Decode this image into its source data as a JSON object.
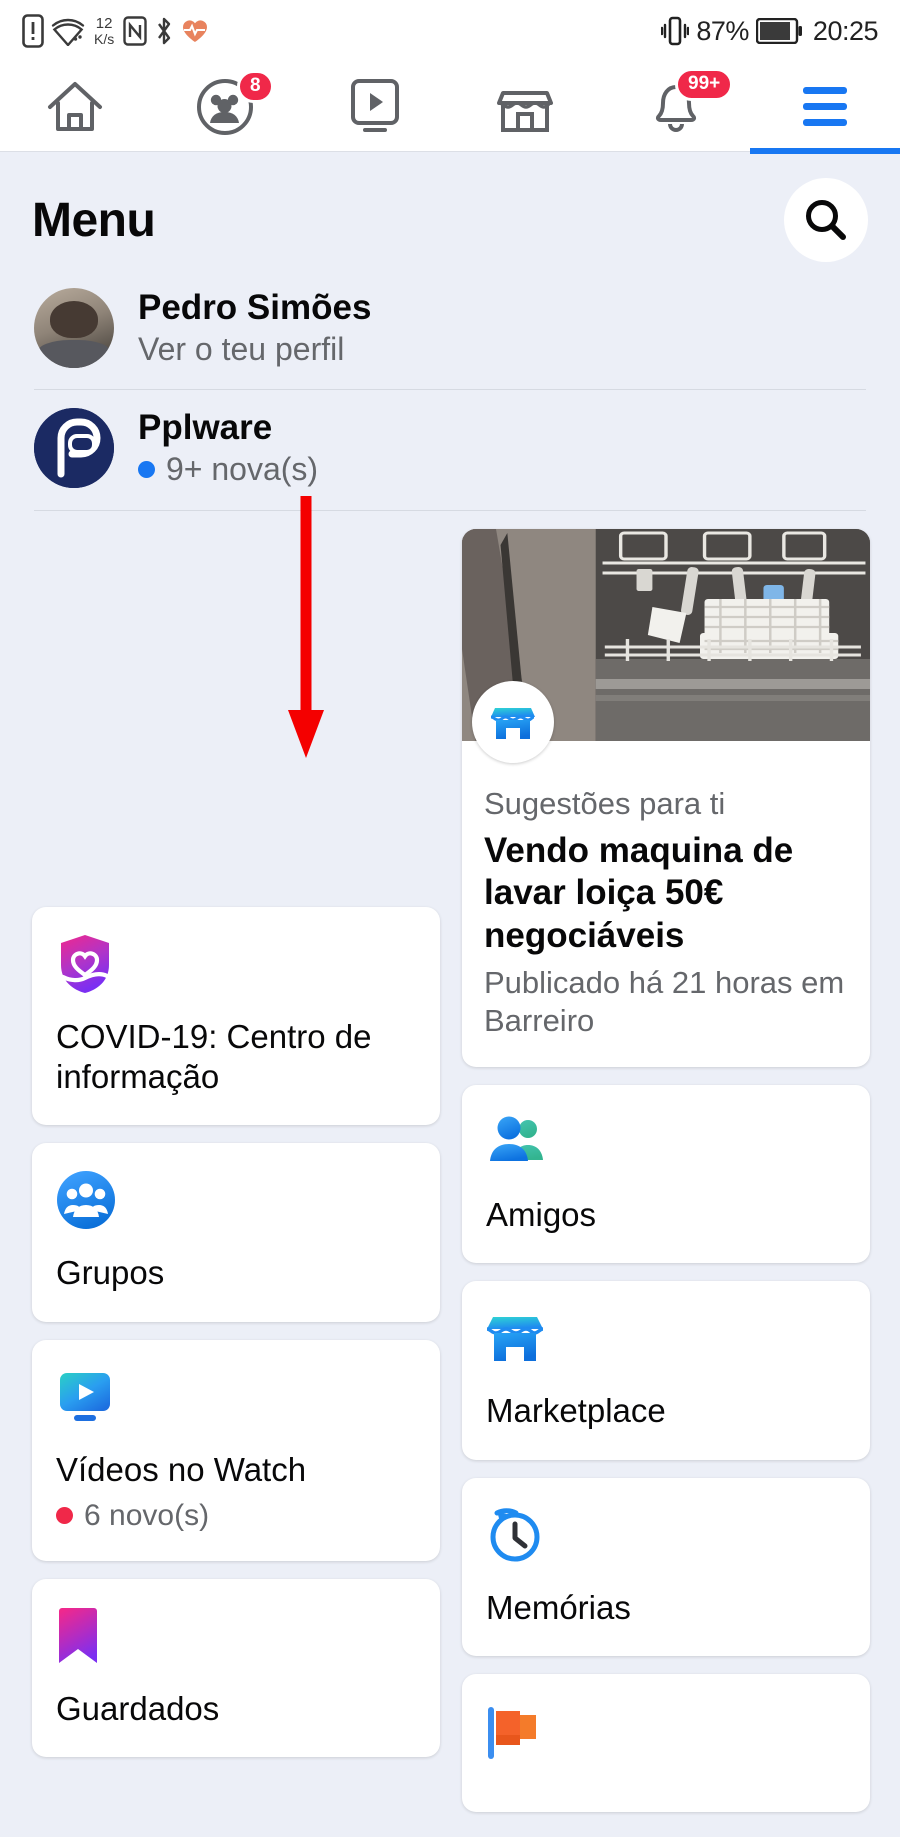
{
  "statusbar": {
    "network_speed_value": "12",
    "network_speed_unit": "K/s",
    "battery_percent": "87%",
    "clock": "20:25",
    "icons": [
      "sim-card-alert-icon",
      "wifi-icon",
      "nfc-icon",
      "bluetooth-icon",
      "heart-rate-icon",
      "vibrate-icon",
      "battery-icon"
    ]
  },
  "topnav": {
    "tabs": [
      {
        "name": "home-tab",
        "icon": "home-icon",
        "badge": ""
      },
      {
        "name": "friends-tab",
        "icon": "friends-icon",
        "badge": "8"
      },
      {
        "name": "watch-tab",
        "icon": "video-play-icon",
        "badge": ""
      },
      {
        "name": "marketplace-tab",
        "icon": "storefront-icon",
        "badge": ""
      },
      {
        "name": "notifications-tab",
        "icon": "bell-icon",
        "badge": "99+"
      },
      {
        "name": "menu-tab",
        "icon": "hamburger-icon",
        "badge": ""
      }
    ],
    "active_tab": "menu-tab",
    "accent_color": "#1877f2",
    "badge_color": "#f02849"
  },
  "header": {
    "title": "Menu",
    "search_icon": "search-icon"
  },
  "profile": {
    "name": "Pedro Simões",
    "subtitle": "Ver o teu perfil"
  },
  "page_shortcut": {
    "name": "Pplware",
    "badge_text": "9+ nova(s)",
    "dot_color": "#1877f2",
    "logo": "pplware-logo"
  },
  "promo_card": {
    "icon": "marketplace-storefront-icon",
    "kicker": "Sugestões para ti",
    "title": "Vendo maquina de lavar loiça 50€ negociáveis",
    "meta": "Publicado há 21 horas em Barreiro",
    "image_alt": "dishwasher-photo"
  },
  "left_column": [
    {
      "name": "covid-information-center",
      "icon": "covid-shield-heart-icon",
      "label": "COVID-19: Centro de informação",
      "sublabel": "",
      "dot_color": ""
    },
    {
      "name": "groups",
      "icon": "groups-icon",
      "label": "Grupos",
      "sublabel": "",
      "dot_color": ""
    },
    {
      "name": "watch-videos",
      "icon": "watch-video-icon",
      "label": "Vídeos no Watch",
      "sublabel": "6 novo(s)",
      "dot_color": "#f02849"
    },
    {
      "name": "saved",
      "icon": "bookmark-icon",
      "label": "Guardados",
      "sublabel": "",
      "dot_color": ""
    }
  ],
  "right_column": [
    {
      "name": "friends",
      "icon": "friends-two-people-icon",
      "label": "Amigos",
      "sublabel": "",
      "dot_color": ""
    },
    {
      "name": "marketplace",
      "icon": "marketplace-storefront-icon",
      "label": "Marketplace",
      "sublabel": "",
      "dot_color": ""
    },
    {
      "name": "memories",
      "icon": "memories-clock-icon",
      "label": "Memórias",
      "sublabel": "",
      "dot_color": ""
    },
    {
      "name": "pages",
      "icon": "pages-flag-icon",
      "label": "",
      "sublabel": "",
      "dot_color": ""
    }
  ],
  "annotation": {
    "arrow_color": "#f40000",
    "arrow_direction": "down"
  }
}
